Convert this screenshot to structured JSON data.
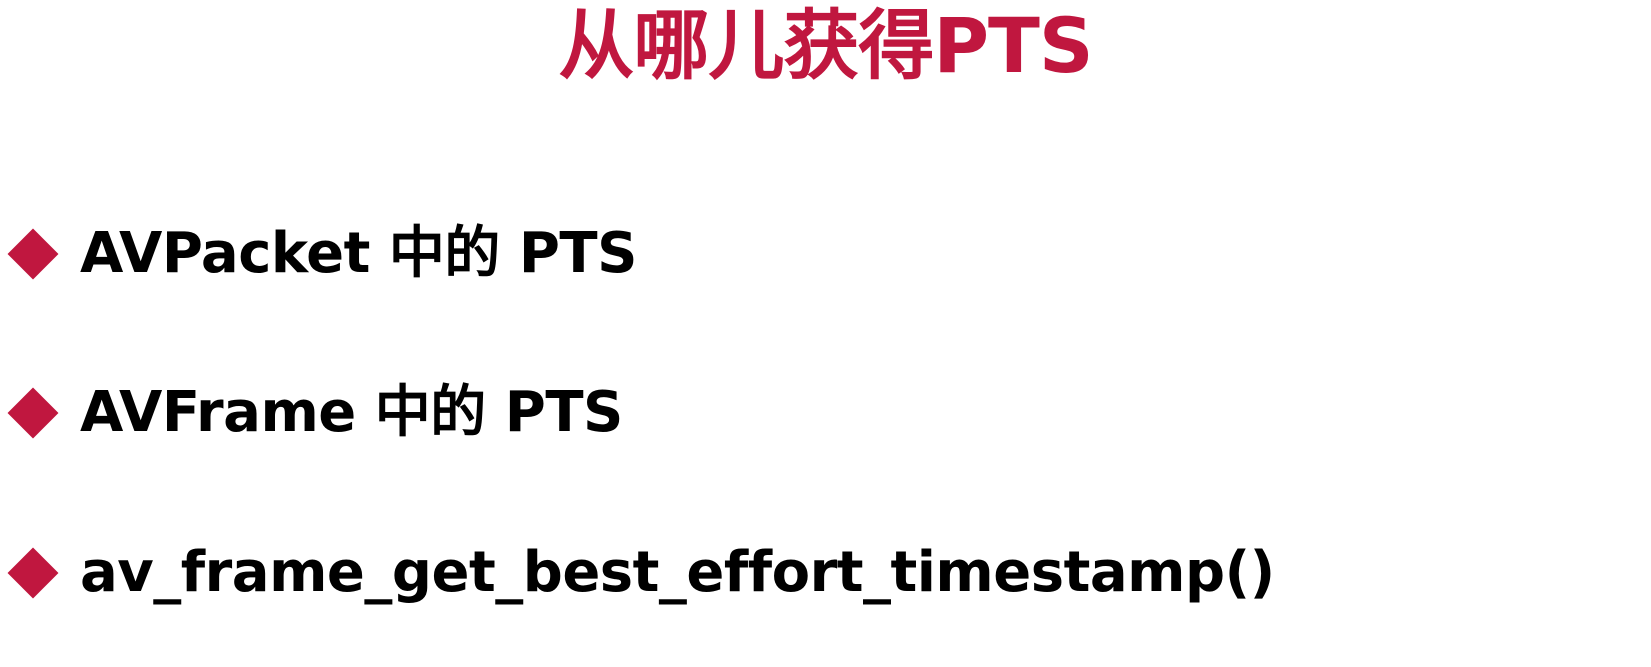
{
  "title": "从哪儿获得PTS",
  "accent_color": "#c0173f",
  "bullet_icon": "diamond-bullet-icon",
  "bullets": [
    {
      "text": "AVPacket 中的 PTS"
    },
    {
      "text": "AVFrame 中的 PTS"
    },
    {
      "text": "av_frame_get_best_effort_timestamp()"
    }
  ]
}
